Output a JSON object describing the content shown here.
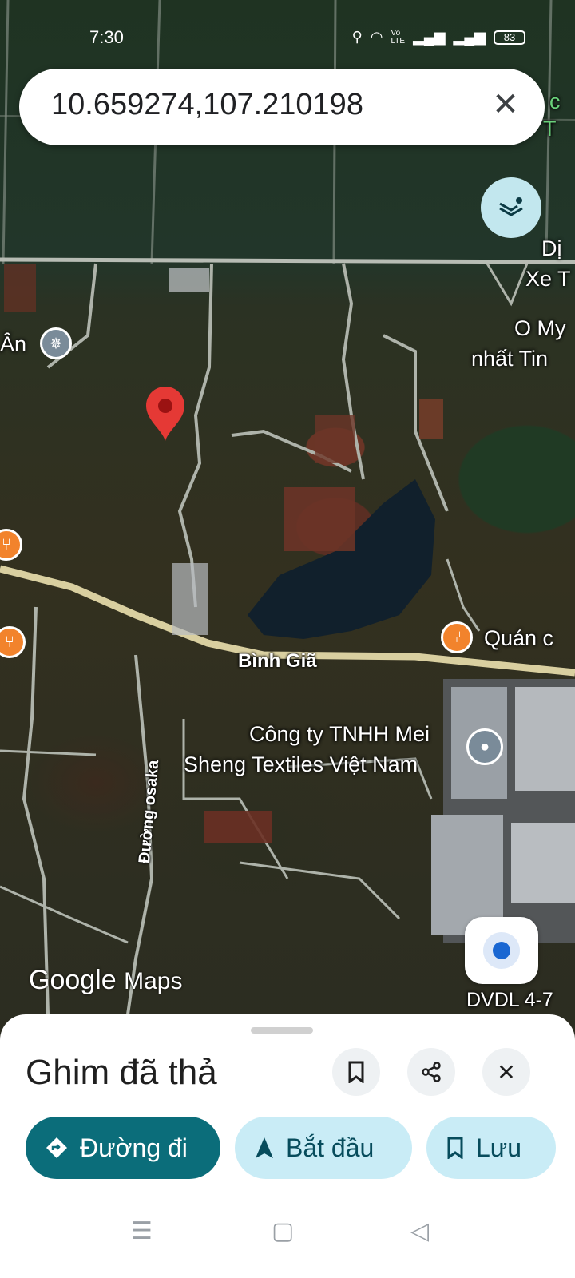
{
  "status_bar": {
    "time": "7:30",
    "battery": "83"
  },
  "search": {
    "value": "10.659274,107.210198"
  },
  "map": {
    "labels": {
      "di": "Dị",
      "xe": "Xe T",
      "o_my": "O My",
      "nhat_tin": "nhất Tin",
      "an": "Ân",
      "quan": "Quán c",
      "company_line1": "Công ty TNHH Mei",
      "company_line2": "Sheng Textiles Việt Nam",
      "dvdl": "DVDL 4-7",
      "top_right_c": "c",
      "top_right_t": "T"
    },
    "roads": {
      "binh_gia": "Bình Giã",
      "osaka": "Đường osaka"
    },
    "logo_google": "Google",
    "logo_maps": "Maps"
  },
  "sheet": {
    "title": "Ghim đã thả",
    "actions": [
      {
        "label": "Đường đi"
      },
      {
        "label": "Bắt đầu"
      },
      {
        "label": "Lưu"
      }
    ]
  },
  "colors": {
    "primary": "#0b6d7a",
    "secondary": "#c9ecf6",
    "pin": "#e53935",
    "poi_food": "#f2832c"
  }
}
